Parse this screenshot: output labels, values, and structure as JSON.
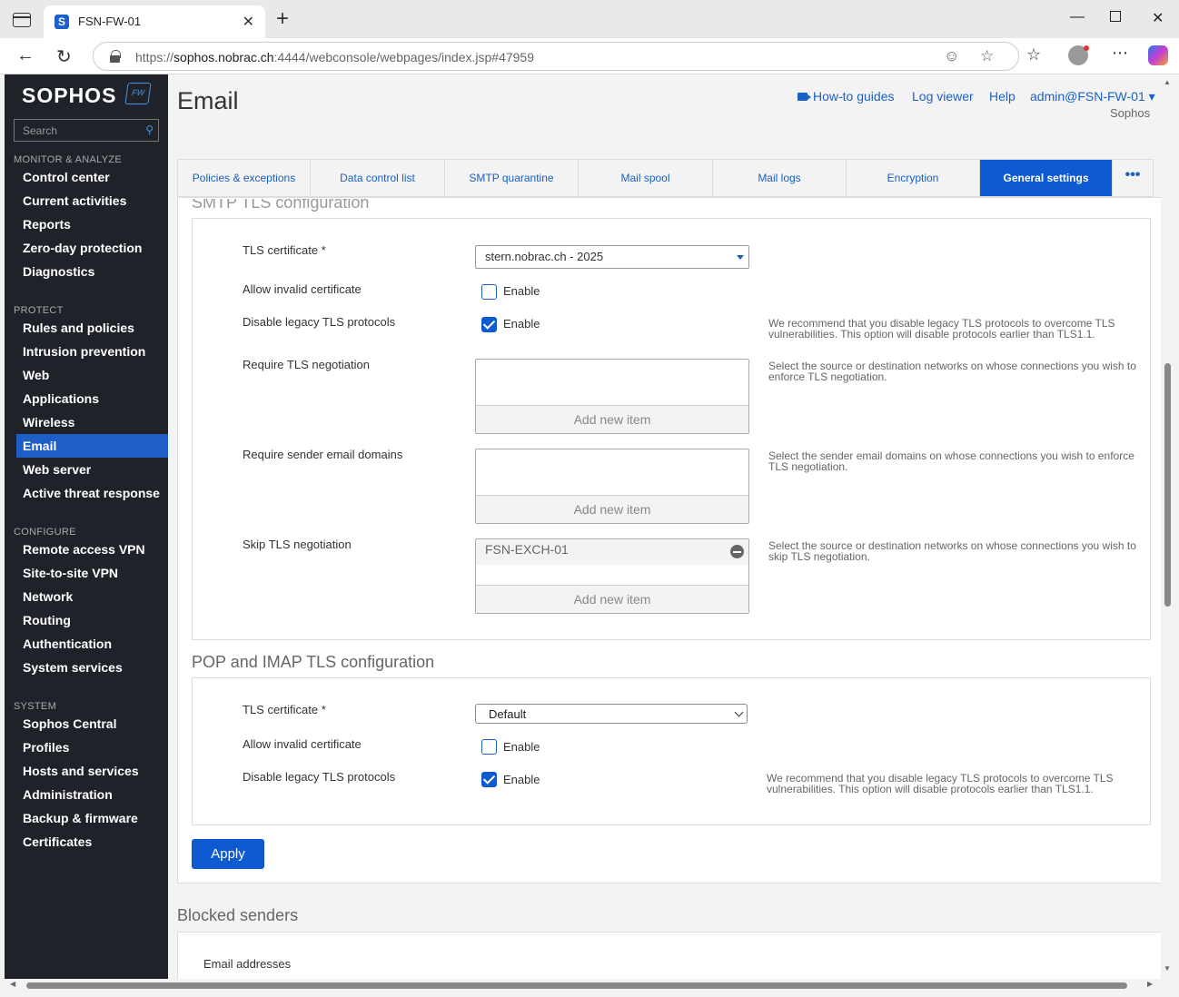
{
  "browser": {
    "tab_title": "FSN-FW-01",
    "url_prefix": "https://",
    "url_host": "sophos.nobrac.ch",
    "url_rest": ":4444/webconsole/webpages/index.jsp#47959",
    "favicon_letter": "S"
  },
  "sidebar": {
    "logo": "SOPHOS",
    "logo_badge": "FW",
    "search_placeholder": "Search",
    "sections": [
      {
        "heading": "MONITOR & ANALYZE",
        "items": [
          "Control center",
          "Current activities",
          "Reports",
          "Zero-day protection",
          "Diagnostics"
        ]
      },
      {
        "heading": "PROTECT",
        "items": [
          "Rules and policies",
          "Intrusion prevention",
          "Web",
          "Applications",
          "Wireless",
          "Email",
          "Web server",
          "Active threat response"
        ]
      },
      {
        "heading": "CONFIGURE",
        "items": [
          "Remote access VPN",
          "Site-to-site VPN",
          "Network",
          "Routing",
          "Authentication",
          "System services"
        ]
      },
      {
        "heading": "SYSTEM",
        "items": [
          "Sophos Central",
          "Profiles",
          "Hosts and services",
          "Administration",
          "Backup & firmware",
          "Certificates"
        ]
      }
    ],
    "active_item": "Email"
  },
  "header": {
    "title": "Email",
    "howto": "How-to guides",
    "logviewer": "Log viewer",
    "help": "Help",
    "user": "admin@FSN-FW-01 ▾",
    "org": "Sophos"
  },
  "tabs": [
    "Policies & exceptions",
    "Data control list",
    "SMTP quarantine",
    "Mail spool",
    "Mail logs",
    "Encryption",
    "General settings",
    "•••"
  ],
  "active_tab": "General settings",
  "smtp": {
    "title": "SMTP TLS configuration",
    "tls_cert_label": "TLS certificate",
    "required_mark": "*",
    "tls_cert_value": "stern.nobrac.ch - 2025",
    "allow_invalid_label": "Allow invalid certificate",
    "allow_invalid_checked": false,
    "disable_legacy_label": "Disable legacy TLS protocols",
    "disable_legacy_checked": true,
    "enable": "Enable",
    "disable_legacy_help": "We recommend that you disable legacy TLS protocols to overcome TLS vulnerabilities. This option will disable protocols earlier than TLS1.1.",
    "require_tls_label": "Require TLS negotiation",
    "require_tls_help": "Select the source or destination networks on whose connections you wish to enforce TLS negotiation.",
    "require_sender_label": "Require sender email domains",
    "require_sender_help": "Select the sender email domains on whose connections you wish to enforce TLS negotiation.",
    "skip_tls_label": "Skip TLS negotiation",
    "skip_tls_entries": [
      "FSN-EXCH-01"
    ],
    "skip_tls_help": "Select the source or destination networks on whose connections you wish to skip TLS negotiation.",
    "add_new_item": "Add new item"
  },
  "pop": {
    "title": "POP and IMAP TLS configuration",
    "tls_cert_label": "TLS certificate",
    "required_mark": "*",
    "tls_cert_value": "Default",
    "allow_invalid_label": "Allow invalid certificate",
    "allow_invalid_checked": false,
    "disable_legacy_label": "Disable legacy TLS protocols",
    "disable_legacy_checked": true,
    "enable": "Enable",
    "disable_legacy_help": "We recommend that you disable legacy TLS protocols to overcome TLS vulnerabilities. This option will disable protocols earlier than TLS1.1."
  },
  "apply_label": "Apply",
  "blocked": {
    "title": "Blocked senders",
    "email_label": "Email addresses"
  }
}
